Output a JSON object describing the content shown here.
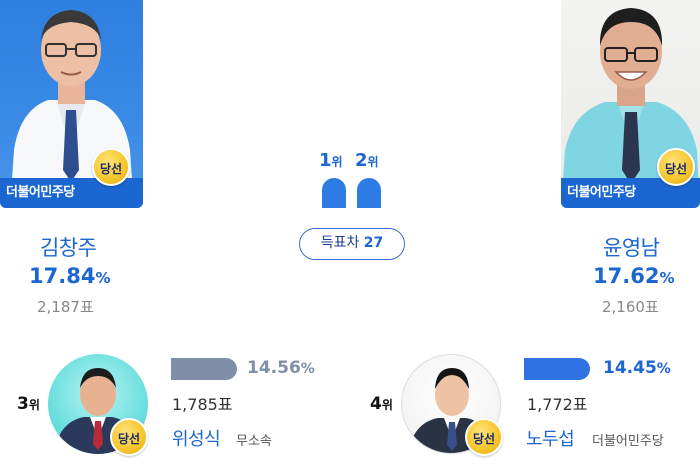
{
  "winner_badge": "당선",
  "candidates_top": [
    {
      "name": "김창주",
      "party": "더불어민주당",
      "percent": "17.84",
      "unit": "%",
      "votes": "2,187표"
    },
    {
      "name": "윤영남",
      "party": "더불어민주당",
      "percent": "17.62",
      "unit": "%",
      "votes": "2,160표"
    }
  ],
  "ranks": {
    "first": {
      "num": "1",
      "suffix": "위"
    },
    "second": {
      "num": "2",
      "suffix": "위"
    }
  },
  "gap": {
    "label": "득표차",
    "value": "27"
  },
  "candidates_bottom": [
    {
      "rank_num": "3",
      "rank_suffix": "위",
      "name": "위성식",
      "party": "무소속",
      "percent": "14.56",
      "unit": "%",
      "votes": "1,785표",
      "bar_color": "#7f8fa8",
      "pct_color": "#7f8fa8"
    },
    {
      "rank_num": "4",
      "rank_suffix": "위",
      "name": "노두섭",
      "party": "더불어민주당",
      "percent": "14.45",
      "unit": "%",
      "votes": "1,772표",
      "bar_color": "#2f72e2",
      "pct_color": "#1b66d1"
    }
  ],
  "colors": {
    "accent": "#1b66d1",
    "party_bar": "#1b66d1",
    "badge": "#f5c52a"
  }
}
